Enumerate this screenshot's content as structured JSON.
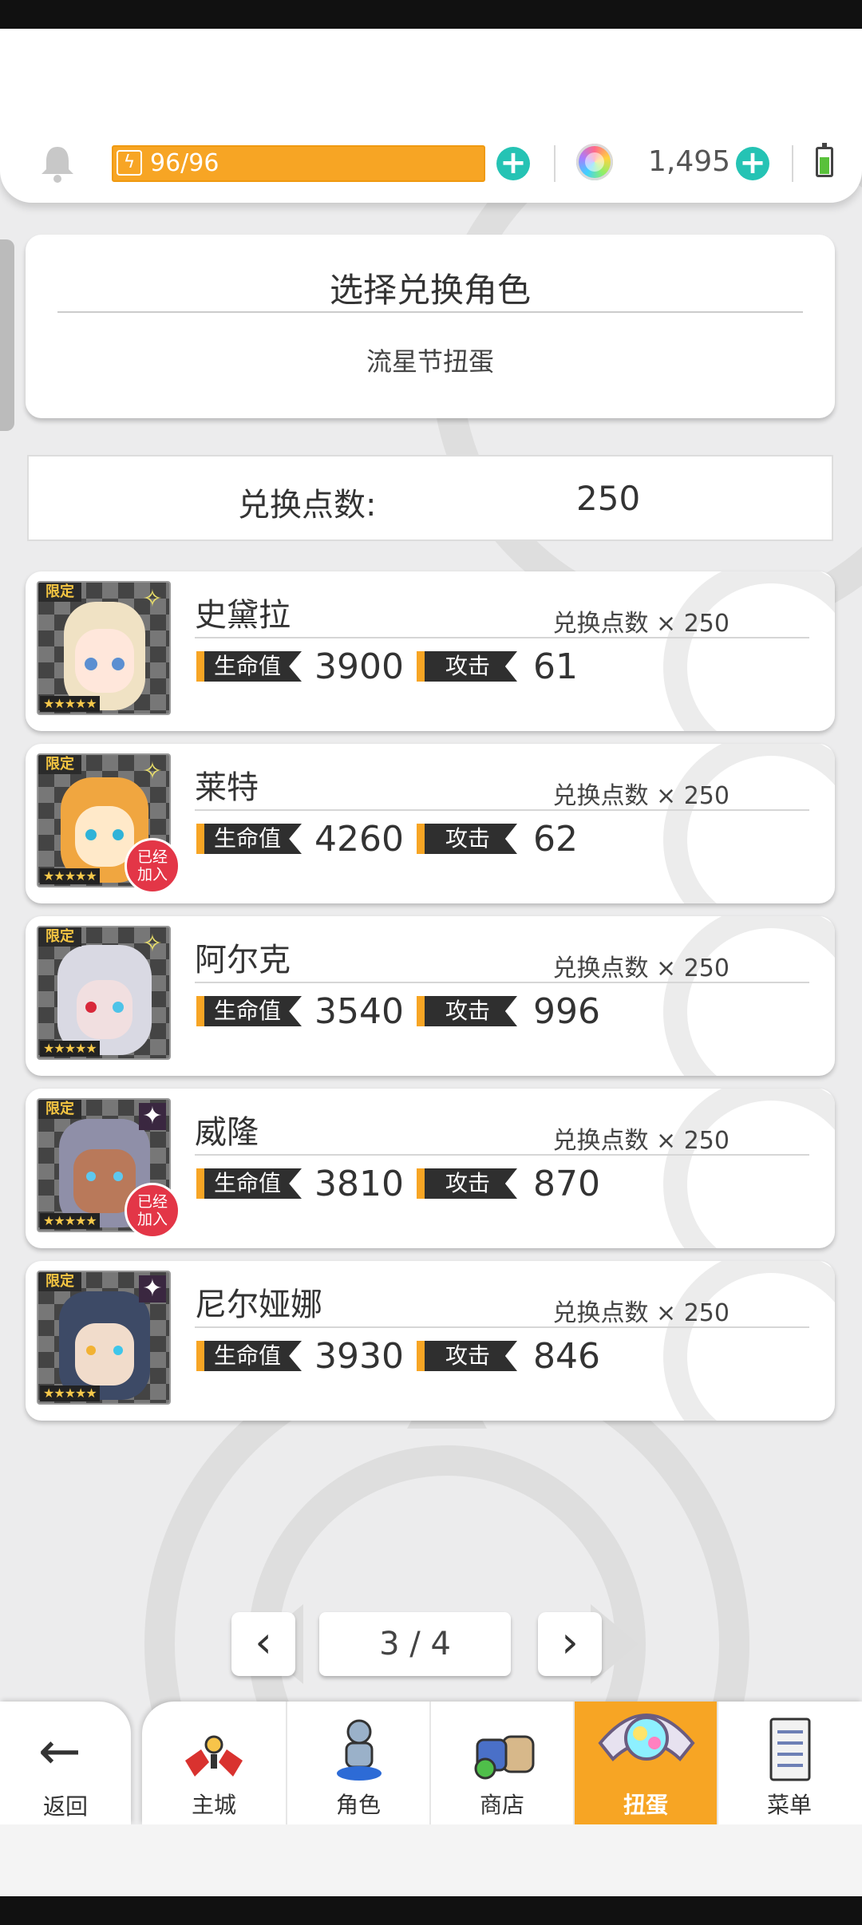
{
  "header": {
    "stamina": "96/96",
    "gems": "1,495"
  },
  "title_card": {
    "title": "选择兑换角色",
    "subtitle": "流星节扭蛋"
  },
  "points": {
    "label": "兑换点数:",
    "value": "250"
  },
  "tags": {
    "limited": "限定",
    "stars": "★★★★★",
    "joined": "已经加入"
  },
  "labels": {
    "hp": "生命值",
    "atk": "攻击"
  },
  "characters": [
    {
      "name": "史黛拉",
      "cost": "兑换点数 × 250",
      "hp": "3900",
      "atk": "61",
      "element": "light",
      "joined": false
    },
    {
      "name": "莱特",
      "cost": "兑换点数 × 250",
      "hp": "4260",
      "atk": "62",
      "element": "light",
      "joined": true
    },
    {
      "name": "阿尔克",
      "cost": "兑换点数 × 250",
      "hp": "3540",
      "atk": "996",
      "element": "light",
      "joined": false
    },
    {
      "name": "威隆",
      "cost": "兑换点数 × 250",
      "hp": "3810",
      "atk": "870",
      "element": "dark",
      "joined": true
    },
    {
      "name": "尼尔娅娜",
      "cost": "兑换点数 × 250",
      "hp": "3930",
      "atk": "846",
      "element": "dark",
      "joined": false
    }
  ],
  "pager": {
    "page": "3 / 4"
  },
  "nav": {
    "back": "返回",
    "items": [
      {
        "label": "主城",
        "icon": "castle-icon"
      },
      {
        "label": "角色",
        "icon": "character-icon"
      },
      {
        "label": "商店",
        "icon": "shop-icon"
      },
      {
        "label": "扭蛋",
        "icon": "gacha-icon"
      },
      {
        "label": "菜单",
        "icon": "menu-icon"
      }
    ],
    "active_index": 3
  },
  "colors": {
    "accent_orange": "#f7a524",
    "teal": "#25c3b4",
    "badge_red": "#e33647"
  }
}
